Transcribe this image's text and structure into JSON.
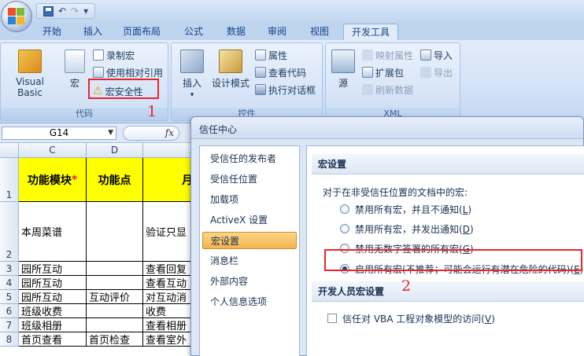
{
  "qat": {
    "undo": "↶",
    "redo": "↷",
    "more": "▾"
  },
  "tabs": [
    "开始",
    "插入",
    "页面布局",
    "公式",
    "数据",
    "审阅",
    "视图",
    "开发工具"
  ],
  "ribbon": {
    "code_group": {
      "label": "代码",
      "visual_basic": "Visual Basic",
      "macro": "宏",
      "record_macro": "录制宏",
      "relative_ref": "使用相对引用",
      "macro_security": "宏安全性"
    },
    "controls_group": {
      "label": "控件",
      "insert": "插入",
      "design_mode": "设计模式",
      "properties": "属性",
      "view_code": "查看代码",
      "run_dialog": "执行对话框"
    },
    "xml_group": {
      "label": "XML",
      "source": "源",
      "map_props": "映射属性",
      "expansion": "扩展包",
      "refresh": "刷新数据",
      "import": "导入",
      "export": "导出"
    }
  },
  "annotations": {
    "one": "1",
    "two": "2"
  },
  "formula_bar": {
    "name_box": "G14",
    "fx": "fx"
  },
  "sheet": {
    "columns": [
      "C",
      "D"
    ],
    "rows": [
      {
        "num": "1",
        "c": "功能模块",
        "star": "*",
        "d": "功能点",
        "e": "月"
      },
      {
        "num": "2",
        "c": "本周菜谱",
        "d": "",
        "e": "验证只显"
      },
      {
        "num": "3",
        "c": "园所互动",
        "d": "",
        "e": "查看回复"
      },
      {
        "num": "4",
        "c": "园所互动",
        "d": "",
        "e": "查看互动"
      },
      {
        "num": "5",
        "c": "园所互动",
        "d": "互动评价",
        "e": "对互动消"
      },
      {
        "num": "6",
        "c": "班级收费",
        "d": "",
        "e": "收费"
      },
      {
        "num": "7",
        "c": "班级相册",
        "d": "",
        "e": "查看相册"
      },
      {
        "num": "8",
        "c": "首页查看",
        "d": "首页检查",
        "e": "查看室外"
      }
    ]
  },
  "dialog": {
    "title": "信任中心",
    "nav": [
      "受信任的发布者",
      "受信任位置",
      "加载项",
      "ActiveX 设置",
      "宏设置",
      "消息栏",
      "外部内容",
      "个人信息选项"
    ],
    "macro_section": "宏设置",
    "macro_desc": "对于在非受信任位置的文档中的宏:",
    "options": [
      {
        "text": "禁用所有宏，并且不通知",
        "key": "L"
      },
      {
        "text": "禁用所有宏，并发出通知",
        "key": "D"
      },
      {
        "text": "禁用无数字签署的所有宏",
        "key": "G"
      },
      {
        "text": "启用所有宏(不推荐；可能会运行有潜在危险的代码)",
        "key": "E"
      }
    ],
    "dev_section": "开发人员宏设置",
    "vba_trust": {
      "text": "信任对 VBA 工程对象模型的访问",
      "key": "V"
    }
  }
}
